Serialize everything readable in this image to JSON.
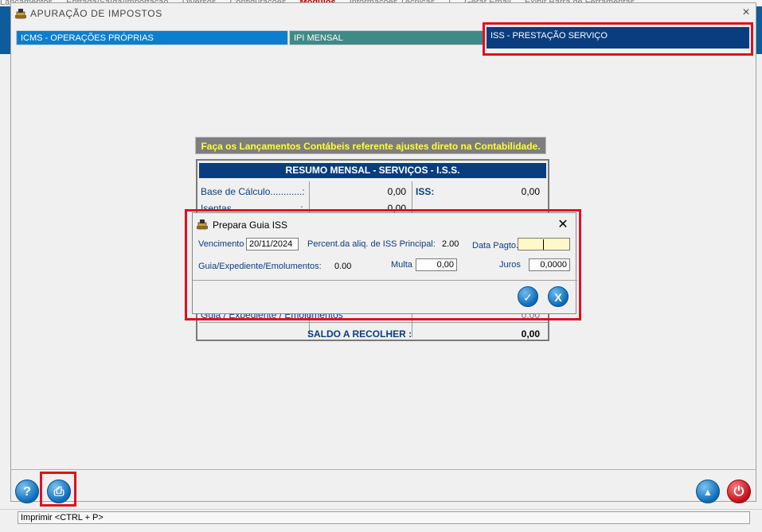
{
  "background_menu": {
    "items": [
      "Lançamentos",
      "Entrada/Saída/Importação",
      "Diversos",
      "Configurações",
      "Módulos",
      "Informações Técnicas",
      "|",
      "Gerar Email",
      "Exibir Barra de Ferramentas"
    ],
    "highlight": "Módulos"
  },
  "window": {
    "title": "APURAÇÃO  DE  IMPOSTOS",
    "close": "×"
  },
  "tabs": [
    {
      "label": "ICMS - OPERAÇÕES PRÓPRIAS"
    },
    {
      "label": "IPI  MENSAL"
    },
    {
      "label": "ISS - PRESTAÇÃO SERVIÇO"
    }
  ],
  "warning": "Faça os Lançamentos Contábeis referente ajustes direto na Contabilidade.",
  "summary": {
    "header": "RESUMO MENSAL  -  SERVIÇOS  -  I.S.S.",
    "rows": [
      {
        "label": "Base de Cálculo............:",
        "value": "0,00"
      },
      {
        "label": "Isentas..........................:",
        "value": "0,00"
      }
    ],
    "iss_label": "ISS:",
    "iss_value": "0,00",
    "partial_row": "Guia / Expediente / Emolumentos",
    "partial_value": "0,00",
    "saldo_label": "SALDO A RECOLHER :",
    "saldo_value": "0,00"
  },
  "dialog": {
    "title": "Prepara Guia ISS",
    "close": "✕",
    "vencimento_label": "Vencimento",
    "vencimento_value": "20/11/2024",
    "percent_label": "Percent.da aliq. de ISS Principal:",
    "percent_value": "2.00",
    "data_pagto_label": "Data Pagto.",
    "data_pagto_value": "",
    "guia_label": "Guia/Expediente/Emolumentos:",
    "guia_value": "0.00",
    "multa_label": "Multa",
    "multa_value": "0,00",
    "juros_label": "Juros",
    "juros_value": "0,0000",
    "ok_glyph": "✓",
    "cancel_glyph": "X"
  },
  "toolbar": {
    "help_glyph": "?",
    "print_glyph": "⎙",
    "up_glyph": "▲",
    "power_glyph": "⏻"
  },
  "status": {
    "text": "Imprimir  <CTRL + P>"
  },
  "colors": {
    "accent_navy": "#0a3d80",
    "tab_blue": "#0a7fcf",
    "tab_teal": "#3f8a86",
    "highlight_red": "#e01020",
    "warning_yellow": "#ffff33"
  }
}
